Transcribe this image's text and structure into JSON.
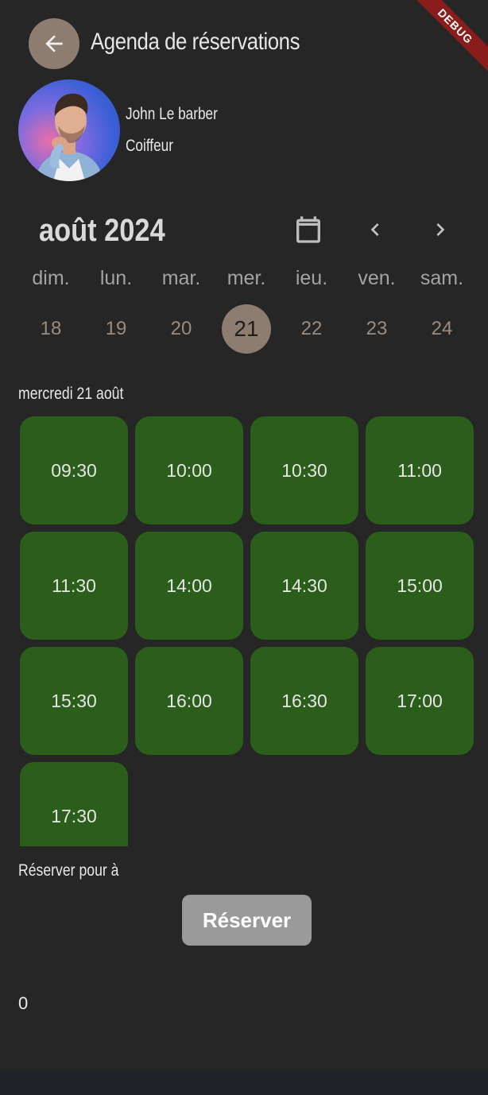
{
  "header": {
    "title": "Agenda de réservations",
    "back_icon": "arrow-left-icon",
    "debug_label": "DEBUG"
  },
  "profile": {
    "name": "John Le barber",
    "role": "Coiffeur"
  },
  "calendar": {
    "month": "août 2024",
    "weekdays": [
      "dim.",
      "lun.",
      "mar.",
      "mer.",
      "ieu.",
      "ven.",
      "sam."
    ],
    "days": [
      "18",
      "19",
      "20",
      "21",
      "22",
      "23",
      "24"
    ],
    "selected_day": "21"
  },
  "selected_date_label": "mercredi 21 août",
  "slots": [
    "09:30",
    "10:00",
    "10:30",
    "11:00",
    "11:30",
    "14:00",
    "14:30",
    "15:00",
    "15:30",
    "16:00",
    "16:30",
    "17:00",
    "17:30"
  ],
  "booking": {
    "reserve_for": "Réserver pour  à",
    "button_label": "Réserver"
  },
  "counter": "0",
  "colors": {
    "background": "#262626",
    "accent": "#8d7c70",
    "slot": "#2b5e1a",
    "button": "#9a9a9a"
  }
}
